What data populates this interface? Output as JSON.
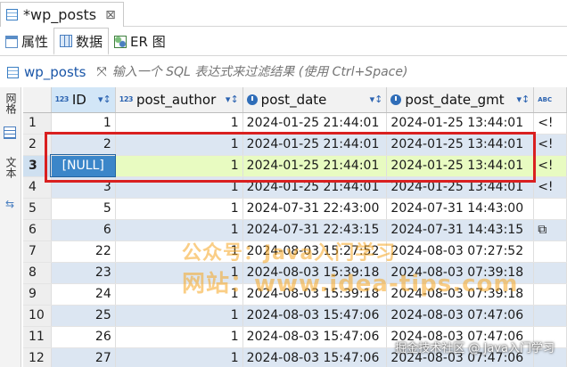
{
  "editor_tab": {
    "title": "*wp_posts",
    "close_glyph": "⊠"
  },
  "subtabs": [
    {
      "label": "属性",
      "icon": "properties-icon"
    },
    {
      "label": "数据",
      "icon": "data-grid-icon"
    },
    {
      "label": "ER 图",
      "icon": "er-diagram-icon"
    }
  ],
  "filter": {
    "table_name": "wp_posts",
    "placeholder": "输入一个 SQL 表达式来过滤结果 (使用 Ctrl+Space)"
  },
  "side_tabs": {
    "grid": "网格",
    "text": "文本"
  },
  "columns": [
    {
      "name": "ID",
      "type": "123"
    },
    {
      "name": "post_author",
      "type": "123"
    },
    {
      "name": "post_date",
      "type": "clock"
    },
    {
      "name": "post_date_gmt",
      "type": "clock"
    },
    {
      "name": "",
      "type": "ABC"
    }
  ],
  "rows": [
    {
      "num": "1",
      "id": "1",
      "author": "1",
      "date": "2024-01-25 21:44:01",
      "gmt": "2024-01-25 13:44:01",
      "extra": "<!"
    },
    {
      "num": "2",
      "id": "2",
      "author": "1",
      "date": "2024-01-25 21:44:01",
      "gmt": "2024-01-25 13:44:01",
      "extra": "<!"
    },
    {
      "num": "3",
      "id": "[NULL]",
      "author": "1",
      "date": "2024-01-25 21:44:01",
      "gmt": "2024-01-25 13:44:01",
      "extra": "<!"
    },
    {
      "num": "4",
      "id": "3",
      "author": "1",
      "date": "2024-01-25 21:44:01",
      "gmt": "2024-01-25 13:44:01",
      "extra": "<!"
    },
    {
      "num": "5",
      "id": "5",
      "author": "1",
      "date": "2024-07-31 22:43:00",
      "gmt": "2024-07-31 14:43:00",
      "extra": ""
    },
    {
      "num": "6",
      "id": "6",
      "author": "1",
      "date": "2024-07-31 22:43:15",
      "gmt": "2024-07-31 14:43:15",
      "extra": "⧉"
    },
    {
      "num": "7",
      "id": "22",
      "author": "1",
      "date": "2024-08-03 15:27:52",
      "gmt": "2024-08-03 07:27:52",
      "extra": ""
    },
    {
      "num": "8",
      "id": "23",
      "author": "1",
      "date": "2024-08-03 15:39:18",
      "gmt": "2024-08-03 07:39:18",
      "extra": ""
    },
    {
      "num": "9",
      "id": "24",
      "author": "1",
      "date": "2024-08-03 15:39:18",
      "gmt": "2024-08-03 07:39:18",
      "extra": ""
    },
    {
      "num": "10",
      "id": "25",
      "author": "1",
      "date": "2024-08-03 15:47:06",
      "gmt": "2024-08-03 07:47:06",
      "extra": ""
    },
    {
      "num": "11",
      "id": "26",
      "author": "1",
      "date": "2024-08-03 15:47:06",
      "gmt": "2024-08-03 07:47:06",
      "extra": ""
    },
    {
      "num": "12",
      "id": "27",
      "author": "1",
      "date": "2024-08-03 15:47:06",
      "gmt": "2024-08-03 07:47:06",
      "extra": ""
    }
  ],
  "watermarks": {
    "line1": "公众号：Java入门学习",
    "line2": "网站：www.idea-tips.com",
    "corner": "掘金技术社区 @ Java入门学习"
  },
  "colors": {
    "selected_row": "#e8fbc1",
    "alt_row": "#dce6f2",
    "selected_cell": "#3b86c9",
    "highlight": "#d92020",
    "watermark": "#f5a623"
  }
}
